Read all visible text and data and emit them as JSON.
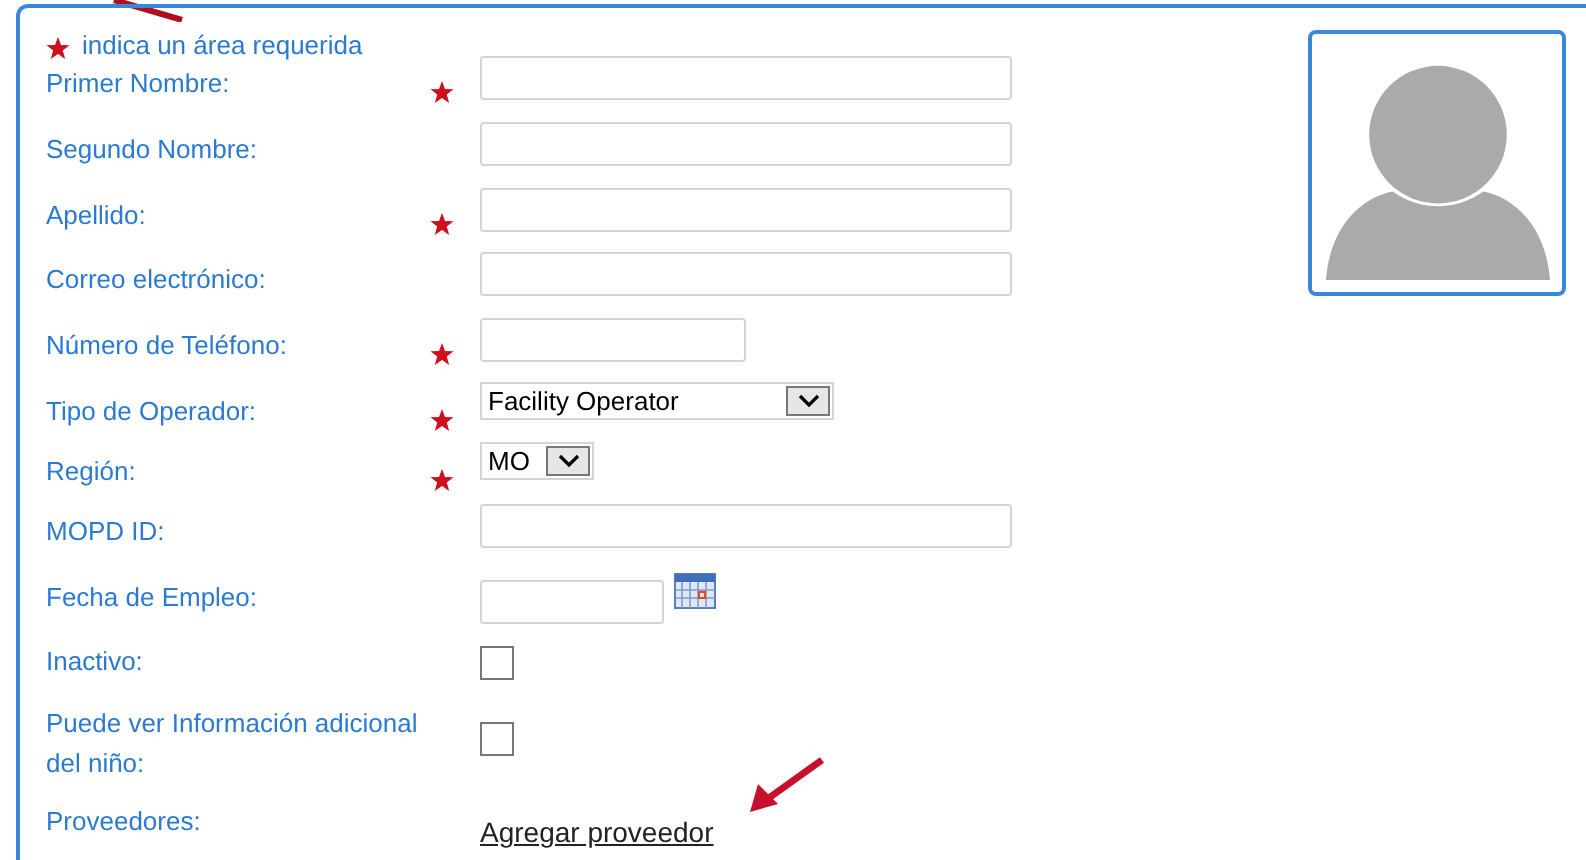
{
  "required_note": "indica un área requerida",
  "fields": [
    {
      "kind": "text",
      "label": "Primer Nombre:",
      "required": true
    },
    {
      "kind": "text",
      "label": "Segundo Nombre:",
      "required": false
    },
    {
      "kind": "text",
      "label": "Apellido:",
      "required": true
    },
    {
      "kind": "text",
      "label": "Correo electrónico:",
      "required": false
    },
    {
      "kind": "short_text",
      "label": "Número de Teléfono:",
      "required": true
    },
    {
      "kind": "select",
      "label": "Tipo de Operador:",
      "required": true,
      "value": "Facility Operator"
    },
    {
      "kind": "short_select",
      "label": "Región:",
      "required": true,
      "value": "MO"
    },
    {
      "kind": "text",
      "label": "MOPD ID:",
      "required": false
    },
    {
      "kind": "date",
      "label": "Fecha de Empleo:",
      "required": false
    },
    {
      "kind": "checkbox",
      "label": "Inactivo:",
      "required": false,
      "checked": false
    },
    {
      "kind": "checkbox",
      "label": "Puede ver Información adicional del niño:",
      "required": false,
      "checked": false
    },
    {
      "kind": "link",
      "label": "Proveedores:",
      "required": false,
      "text": "Agregar proveedor"
    }
  ]
}
